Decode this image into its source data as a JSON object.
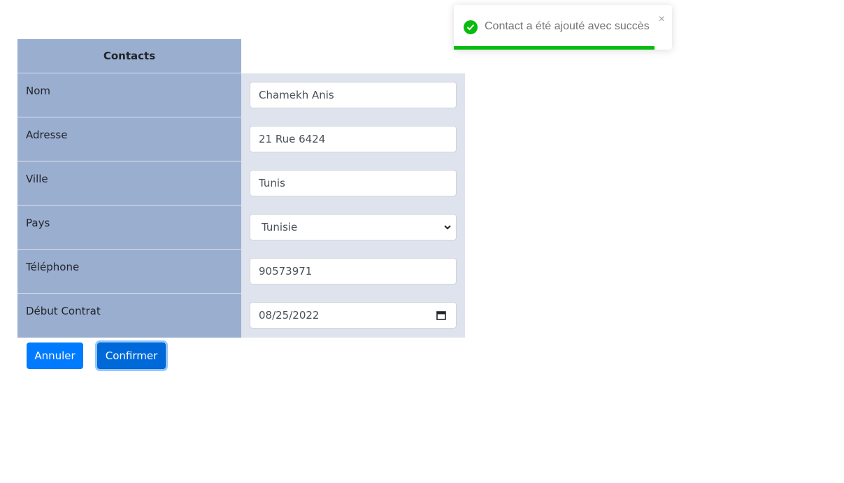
{
  "table": {
    "header": "Contacts",
    "rows": [
      {
        "label": "Nom",
        "value": "Chamekh Anis",
        "kind": "text"
      },
      {
        "label": "Adresse",
        "value": "21 Rue 6424",
        "kind": "text"
      },
      {
        "label": "Ville",
        "value": "Tunis",
        "kind": "text"
      },
      {
        "label": "Pays",
        "value": "Tunisie",
        "kind": "select"
      },
      {
        "label": "Téléphone",
        "value": "90573971",
        "kind": "text"
      },
      {
        "label": "Début Contrat",
        "value": "08/25/2022",
        "kind": "date"
      }
    ]
  },
  "buttons": {
    "cancel_label": "Annuler",
    "confirm_label": "Confirmer"
  },
  "toast": {
    "message": "Contact a été ajouté avec succès",
    "close_glyph": "×",
    "icon": "check-circle-icon",
    "progress": 0.92,
    "color": "#07bc0c"
  },
  "colors": {
    "label_bg": "#9aaed0",
    "input_bg": "#dfe3ee",
    "button_primary": "#007bff"
  }
}
